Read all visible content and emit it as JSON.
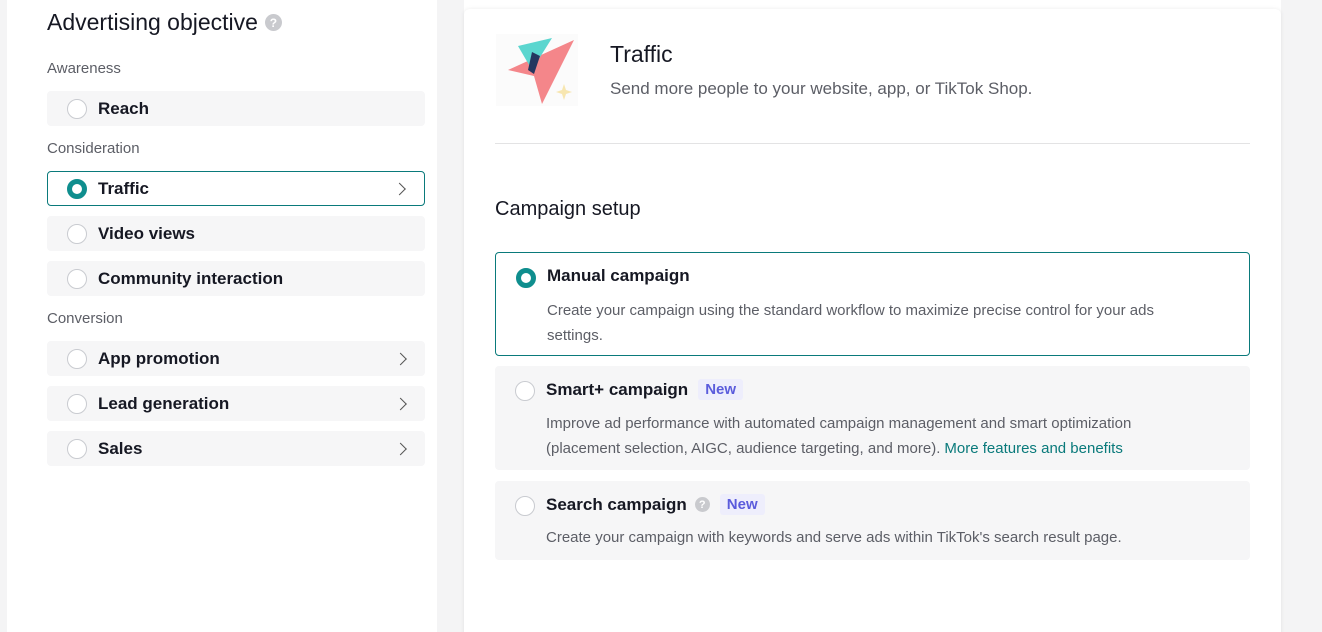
{
  "left": {
    "title": "Advertising objective",
    "help_icon": "question-circle-icon",
    "groups": [
      {
        "label": "Awareness",
        "options": [
          {
            "label": "Reach",
            "selected": false,
            "has_chevron": false
          }
        ]
      },
      {
        "label": "Consideration",
        "options": [
          {
            "label": "Traffic",
            "selected": true,
            "has_chevron": true
          },
          {
            "label": "Video views",
            "selected": false,
            "has_chevron": false
          },
          {
            "label": "Community interaction",
            "selected": false,
            "has_chevron": false
          }
        ]
      },
      {
        "label": "Conversion",
        "options": [
          {
            "label": "App promotion",
            "selected": false,
            "has_chevron": true
          },
          {
            "label": "Lead generation",
            "selected": false,
            "has_chevron": true
          },
          {
            "label": "Sales",
            "selected": false,
            "has_chevron": true
          }
        ]
      }
    ]
  },
  "right": {
    "objective": {
      "icon": "paper-plane-icon",
      "title": "Traffic",
      "description": "Send more people to your website, app, or TikTok Shop."
    },
    "setup": {
      "title": "Campaign setup",
      "campaigns": [
        {
          "title": "Manual campaign",
          "selected": true,
          "badge": "",
          "description": "Create your campaign using the standard workflow to maximize precise control for your ads settings.",
          "link": ""
        },
        {
          "title": "Smart+ campaign",
          "selected": false,
          "badge": "New",
          "description": "Improve ad performance with automated campaign management and smart optimization (placement selection, AIGC, audience targeting, and more).",
          "link": "More features and benefits"
        },
        {
          "title": "Search campaign",
          "selected": false,
          "badge": "New",
          "description": "Create your campaign with keywords and serve ads within TikTok's search result page.",
          "link": ""
        }
      ]
    }
  },
  "colors": {
    "accent": "#0f8e8e",
    "badge_text": "#5b5cdc",
    "badge_bg": "#eeeefc"
  }
}
